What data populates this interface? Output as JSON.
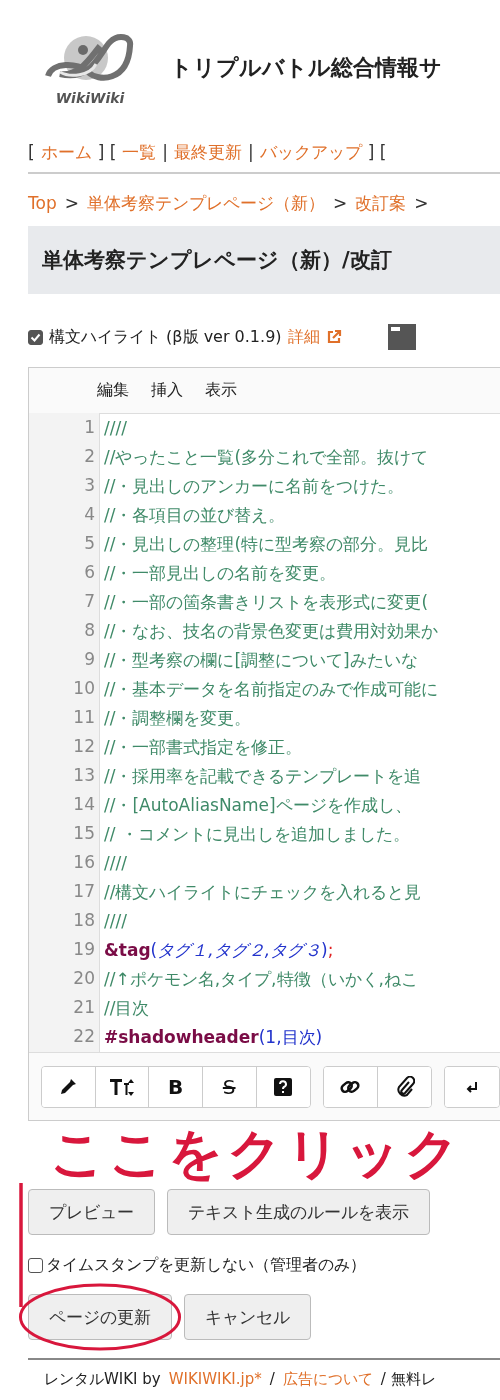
{
  "site": {
    "logo_text": "WikiWiki",
    "title": "トリプルバトル総合情報サ"
  },
  "nav": [
    {
      "kind": "punct",
      "text": "["
    },
    {
      "kind": "link",
      "text": "ホーム"
    },
    {
      "kind": "punct",
      "text": "] ["
    },
    {
      "kind": "link",
      "text": "一覧"
    },
    {
      "kind": "punct",
      "text": "|"
    },
    {
      "kind": "link",
      "text": "最終更新"
    },
    {
      "kind": "punct",
      "text": "|"
    },
    {
      "kind": "link",
      "text": "バックアップ"
    },
    {
      "kind": "punct",
      "text": "] ["
    }
  ],
  "breadcrumb": [
    {
      "kind": "link",
      "text": "Top"
    },
    {
      "kind": "punct",
      "text": ">"
    },
    {
      "kind": "link",
      "text": "単体考察テンプレページ（新）"
    },
    {
      "kind": "punct",
      "text": ">"
    },
    {
      "kind": "link",
      "text": "改訂案"
    },
    {
      "kind": "punct",
      "text": ">"
    }
  ],
  "page_title": "単体考察テンプレページ（新）/改訂",
  "highlight": {
    "checked": true,
    "label": "構文ハイライト (β版 ver 0.1.9)",
    "link": "詳細"
  },
  "editor": {
    "menu": [
      "編集",
      "挿入",
      "表示"
    ],
    "lines": [
      {
        "number": "1",
        "tokens": [
          {
            "kind": "comment",
            "text": "////"
          }
        ]
      },
      {
        "number": "2",
        "tokens": [
          {
            "kind": "comment",
            "text": "//やったこと一覧(多分これで全部。抜けて"
          }
        ]
      },
      {
        "number": "3",
        "tokens": [
          {
            "kind": "comment",
            "text": "//・見出しのアンカーに名前をつけた。"
          }
        ]
      },
      {
        "number": "4",
        "tokens": [
          {
            "kind": "comment",
            "text": "//・各項目の並び替え。"
          }
        ]
      },
      {
        "number": "5",
        "tokens": [
          {
            "kind": "comment",
            "text": "//・見出しの整理(特に型考察の部分。見比"
          }
        ]
      },
      {
        "number": "6",
        "tokens": [
          {
            "kind": "comment",
            "text": "//・一部見出しの名前を変更。"
          }
        ]
      },
      {
        "number": "7",
        "tokens": [
          {
            "kind": "comment",
            "text": "//・一部の箇条書きリストを表形式に変更("
          }
        ]
      },
      {
        "number": "8",
        "tokens": [
          {
            "kind": "comment",
            "text": "//・なお、技名の背景色変更は費用対効果か"
          }
        ]
      },
      {
        "number": "9",
        "tokens": [
          {
            "kind": "comment",
            "text": "//・型考察の欄に[調整について]みたいな"
          }
        ]
      },
      {
        "number": "10",
        "tokens": [
          {
            "kind": "comment",
            "text": "//・基本データを名前指定のみで作成可能に"
          }
        ]
      },
      {
        "number": "11",
        "tokens": [
          {
            "kind": "comment",
            "text": "//・調整欄を変更。"
          }
        ]
      },
      {
        "number": "12",
        "tokens": [
          {
            "kind": "comment",
            "text": "//・一部書式指定を修正。"
          }
        ]
      },
      {
        "number": "13",
        "tokens": [
          {
            "kind": "comment",
            "text": "//・採用率を記載できるテンプレートを追"
          }
        ]
      },
      {
        "number": "14",
        "tokens": [
          {
            "kind": "comment",
            "text": "//・[AutoAliasName]ページを作成し、"
          }
        ]
      },
      {
        "number": "15",
        "tokens": [
          {
            "kind": "comment",
            "text": "// ・コメントに見出しを追加しました。"
          }
        ]
      },
      {
        "number": "16",
        "tokens": [
          {
            "kind": "comment",
            "text": "////"
          }
        ]
      },
      {
        "number": "17",
        "tokens": [
          {
            "kind": "comment",
            "text": "//構文ハイライトにチェックを入れると見"
          }
        ]
      },
      {
        "number": "18",
        "tokens": [
          {
            "kind": "comment",
            "text": "////"
          }
        ]
      },
      {
        "number": "19",
        "tokens": [
          {
            "kind": "keyword",
            "text": "&tag"
          },
          {
            "kind": "paren",
            "text": "("
          },
          {
            "kind": "arg",
            "text": "タグ１,タグ２,タグ３"
          },
          {
            "kind": "paren",
            "text": ")"
          },
          {
            "kind": "end",
            "text": ";"
          }
        ]
      },
      {
        "number": "20",
        "tokens": [
          {
            "kind": "comment",
            "text": "//↑ポケモン名,タイプ,特徴（いかく,ねこ"
          }
        ]
      },
      {
        "number": "21",
        "tokens": [
          {
            "kind": "comment",
            "text": "//目次"
          }
        ]
      },
      {
        "number": "22",
        "tokens": [
          {
            "kind": "keyword",
            "text": "#shadowheader"
          },
          {
            "kind": "paren",
            "text": "(1,目次)"
          }
        ]
      }
    ],
    "toolbar": [
      [
        {
          "kind": "dropper"
        },
        {
          "kind": "size"
        },
        {
          "kind": "bold",
          "label": "B"
        },
        {
          "kind": "strike",
          "label": "S"
        },
        {
          "kind": "help"
        }
      ],
      [
        {
          "kind": "link"
        },
        {
          "kind": "attach"
        }
      ],
      [
        {
          "kind": "return"
        }
      ]
    ]
  },
  "preview_buttons": [
    "プレビュー",
    "テキスト生成のルールを表示"
  ],
  "timestamp": {
    "checked": false,
    "label": "タイムスタンプを更新しない（管理者のみ）"
  },
  "actions": [
    "ページの更新",
    "キャンセル"
  ],
  "annotation": {
    "text": "ここをクリック"
  },
  "footer": [
    {
      "kind": "text",
      "text": "レンタルWIKI by"
    },
    {
      "kind": "link",
      "text": "WIKIWIKI.jp*"
    },
    {
      "kind": "text",
      "text": "/"
    },
    {
      "kind": "link",
      "text": "広告について"
    },
    {
      "kind": "text",
      "text": "/ 無料レ"
    }
  ]
}
